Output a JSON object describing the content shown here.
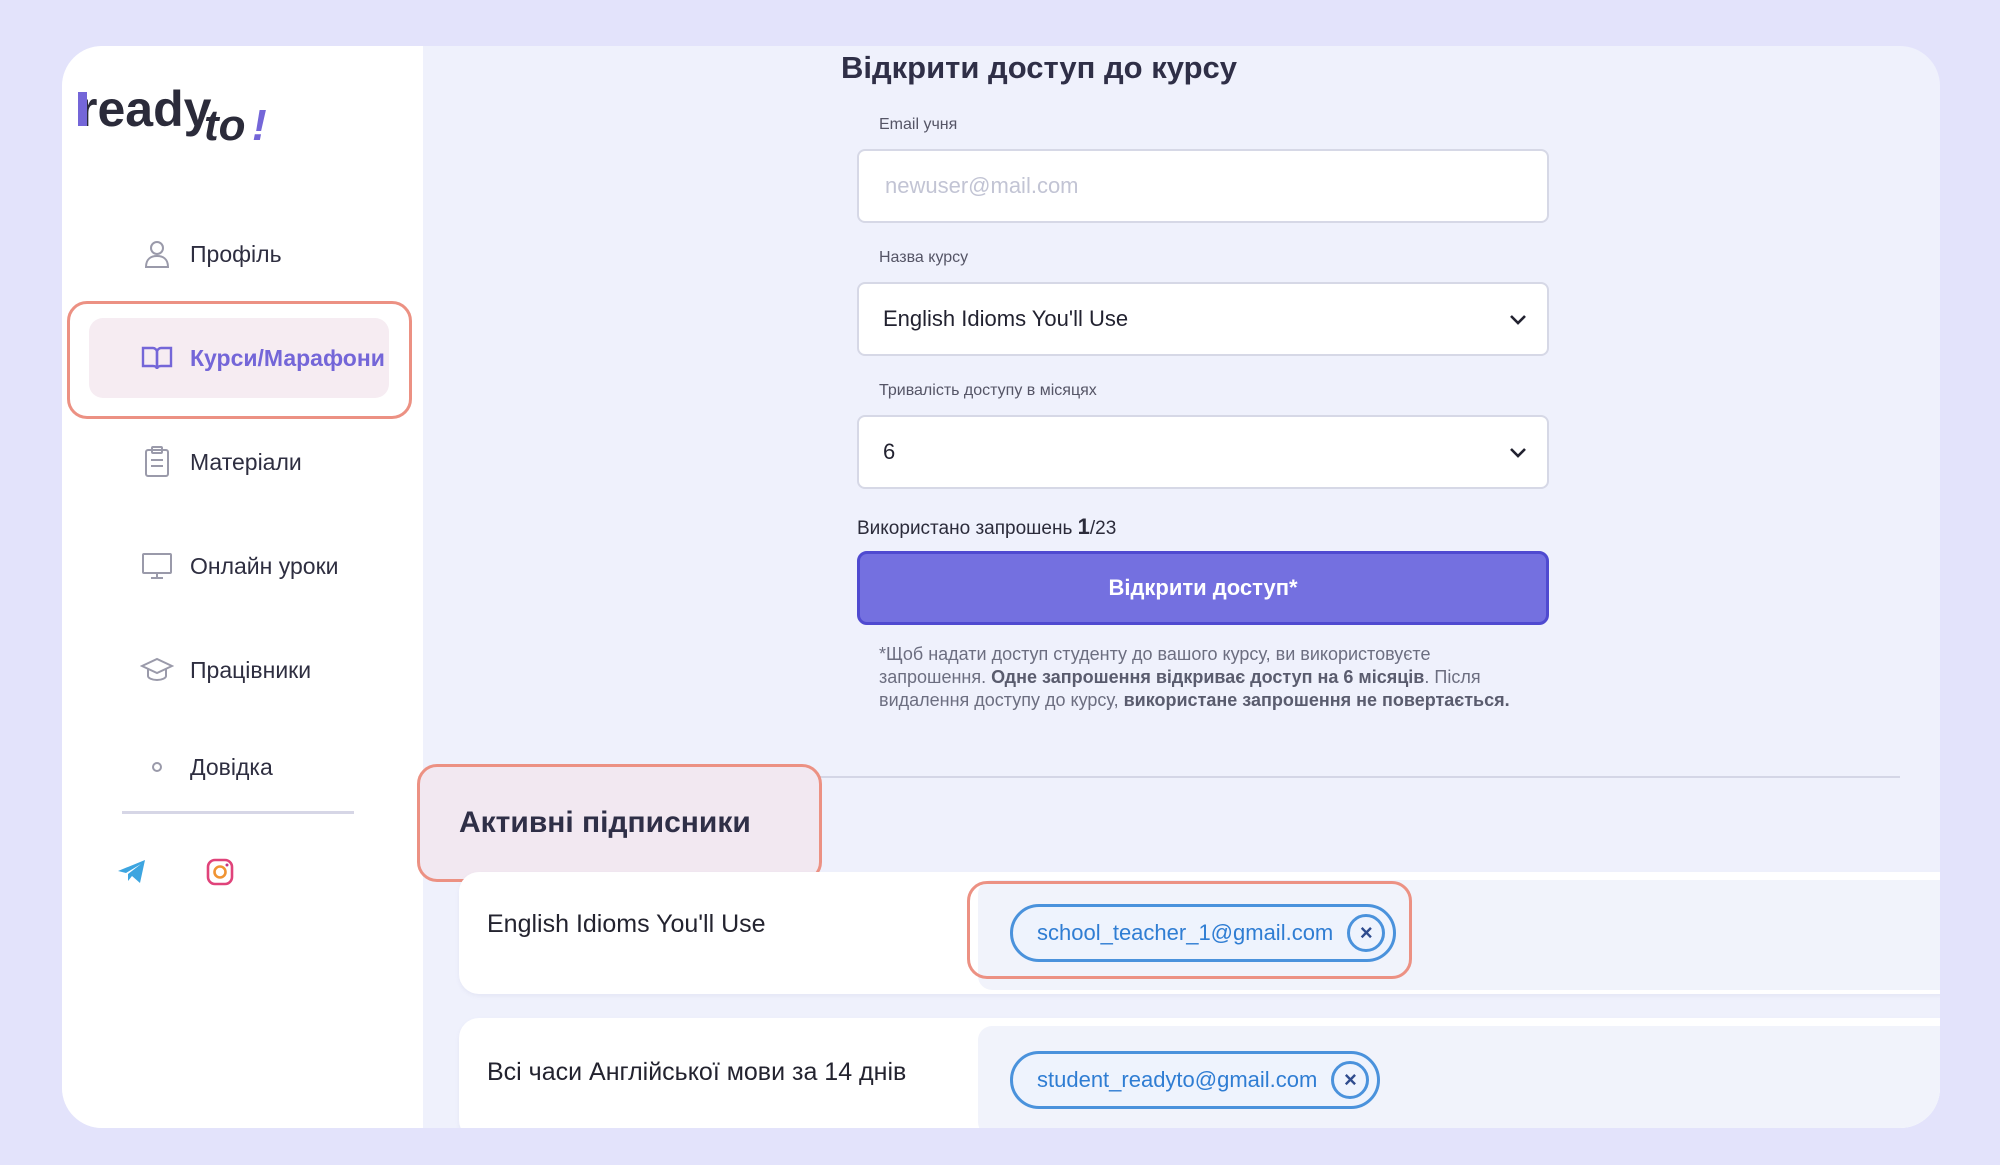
{
  "brand": {
    "logo_ready": "ready",
    "logo_to": "to",
    "logo_bang": "!"
  },
  "sidebar": {
    "items": [
      {
        "label": "Профіль",
        "icon": "user-icon"
      },
      {
        "label": "Курси/Марафони",
        "icon": "book-icon",
        "active": true
      },
      {
        "label": "Матеріали",
        "icon": "clipboard-icon"
      },
      {
        "label": "Онлайн уроки",
        "icon": "monitor-icon"
      },
      {
        "label": "Працівники",
        "icon": "graduation-cap-icon"
      },
      {
        "label": "Довідка",
        "icon": "dot-icon"
      }
    ],
    "social": [
      "telegram-icon",
      "instagram-icon"
    ]
  },
  "form": {
    "title": "Відкрити доступ до курсу",
    "email_label": "Email учня",
    "email_placeholder": "newuser@mail.com",
    "course_label": "Назва курсу",
    "course_value": "English Idioms You'll Use",
    "duration_label": "Тривалість доступу в місяцях",
    "duration_value": "6",
    "invites_text": "Використано запрошень ",
    "invites_used": "1",
    "invites_total": "/23",
    "submit_label": "Відкрити доступ*",
    "note_1": "*Щоб надати доступ студенту до вашого курсу, ви використовуєте запрошення. ",
    "note_2": "Одне запрошення відкриває доступ на 6 місяців",
    "note_3": ". Після видалення доступу до курсу, ",
    "note_4": "використане запрошення не повертається."
  },
  "subscribers": {
    "title": "Активні підписники",
    "rows": [
      {
        "course": "English Idioms You'll Use",
        "email": "school_teacher_1@gmail.com"
      },
      {
        "course": "Всі часи Англійської мови за 14 днів",
        "email": "student_readyto@gmail.com"
      }
    ],
    "remove_symbol": "×"
  },
  "colors": {
    "accent": "#7470e0",
    "highlight": "#ec9183",
    "chip_border": "#4a92dc"
  }
}
